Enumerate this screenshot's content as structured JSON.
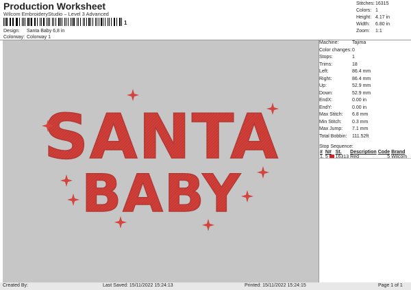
{
  "header": {
    "title": "Production Worksheet",
    "subtitle": "Wilcom EmbroideryStudio – Level 3 Advanced",
    "barcode_suffix": "1"
  },
  "info": {
    "design_label": "Design:",
    "design_value": "Santa Baby 6,8 in",
    "colorway_label": "Colorway:",
    "colorway_value": "Colorway 1"
  },
  "summary": [
    {
      "label": "Stitches:",
      "value": "16315"
    },
    {
      "label": "Colors:",
      "value": "1"
    },
    {
      "label": "Height:",
      "value": "4.17 in"
    },
    {
      "label": "Width:",
      "value": "6.80 in"
    },
    {
      "label": "Zoom:",
      "value": "1:1"
    }
  ],
  "design": {
    "line1": "SANTA",
    "line2": "BABY",
    "thread_color": "#d2453e",
    "background": "#c6c6c6"
  },
  "stats": [
    {
      "label": "Machine:",
      "value": "Tajima"
    },
    {
      "label": "Color changes:",
      "value": "0"
    },
    {
      "label": "Stops:",
      "value": "1"
    },
    {
      "label": "Trims:",
      "value": "18"
    },
    {
      "label": "Left:",
      "value": "86.4 mm"
    },
    {
      "label": "Right:",
      "value": "86.4 mm"
    },
    {
      "label": "Up:",
      "value": "52.9 mm"
    },
    {
      "label": "Down:",
      "value": "52.9 mm"
    },
    {
      "label": "EndX:",
      "value": "0.00 in"
    },
    {
      "label": "EndY:",
      "value": "0.00 in"
    },
    {
      "label": "Max Stitch:",
      "value": "6.8 mm"
    },
    {
      "label": "Min Stitch:",
      "value": "0.3 mm"
    },
    {
      "label": "Max Jump:",
      "value": "7.1 mm"
    },
    {
      "label": "Total Bobbin:",
      "value": "111.52ft"
    }
  ],
  "stop_sequence": {
    "title": "Stop Sequence:",
    "headers": [
      "#",
      "N#",
      "St.",
      "Description",
      "Code",
      "Brand"
    ],
    "rows": [
      {
        "num": "1.",
        "n": "5",
        "swatch": "#d2232a",
        "st": "16313",
        "description": "Red",
        "code": "5",
        "brand": "Wilcom"
      }
    ]
  },
  "footer": {
    "created_by": "Created By:",
    "last_saved": "Last Saved: 15/11/2022 15:24:13",
    "printed": "Printed: 15/11/2022 15:24:15",
    "page": "Page 1 of 1"
  }
}
